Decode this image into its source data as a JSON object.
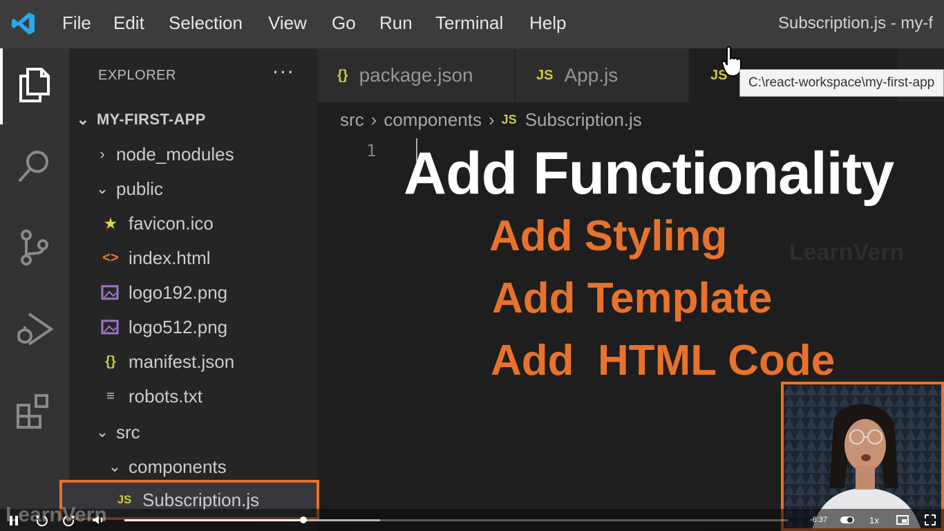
{
  "menubar": {
    "items": [
      "File",
      "Edit",
      "Selection",
      "View",
      "Go",
      "Run",
      "Terminal",
      "Help"
    ],
    "window_title": "Subscription.js - my-f"
  },
  "sidebar": {
    "title": "EXPLORER",
    "more": "···",
    "root": "MY-FIRST-APP",
    "tree": [
      {
        "label": "node_modules",
        "kind": "folder-collapsed"
      },
      {
        "label": "public",
        "kind": "folder-expanded"
      },
      {
        "label": "favicon.ico",
        "icon": "star-icon",
        "color": "#e6d23a"
      },
      {
        "label": "index.html",
        "icon": "html-icon",
        "color": "#e37933"
      },
      {
        "label": "logo192.png",
        "icon": "image-icon",
        "color": "#a074c4"
      },
      {
        "label": "logo512.png",
        "icon": "image-icon",
        "color": "#a074c4"
      },
      {
        "label": "manifest.json",
        "icon": "json-icon",
        "color": "#cbcb41"
      },
      {
        "label": "robots.txt",
        "icon": "text-file-icon",
        "color": "#cccccc"
      },
      {
        "label": "src",
        "kind": "folder-expanded"
      },
      {
        "label": "components",
        "kind": "folder-expanded"
      },
      {
        "label": "Subscription.js",
        "icon": "js-icon",
        "color": "#cbcb41"
      }
    ]
  },
  "tabs": [
    {
      "label": "package.json",
      "icon": "{}",
      "icon_name": "json-icon"
    },
    {
      "label": "App.js",
      "icon": "JS",
      "icon_name": "js-icon"
    },
    {
      "label": "",
      "icon": "JS",
      "icon_name": "js-icon"
    }
  ],
  "tooltip": "C:\\react-workspace\\my-first-app",
  "breadcrumb": {
    "parts": [
      "src",
      "components"
    ],
    "file": "Subscription.js",
    "file_icon": "JS"
  },
  "editor": {
    "line_numbers": [
      "1"
    ]
  },
  "overlay": {
    "heading": "Add Functionality",
    "lines": [
      "Add Styling",
      "Add Template",
      "Add  HTML Code"
    ],
    "accent_color": "#e8722c"
  },
  "watermark": "LearnVern",
  "player": {
    "time_remaining": "-6:37",
    "speed": "1x",
    "progress": 0.27,
    "buffered": 0.385
  }
}
